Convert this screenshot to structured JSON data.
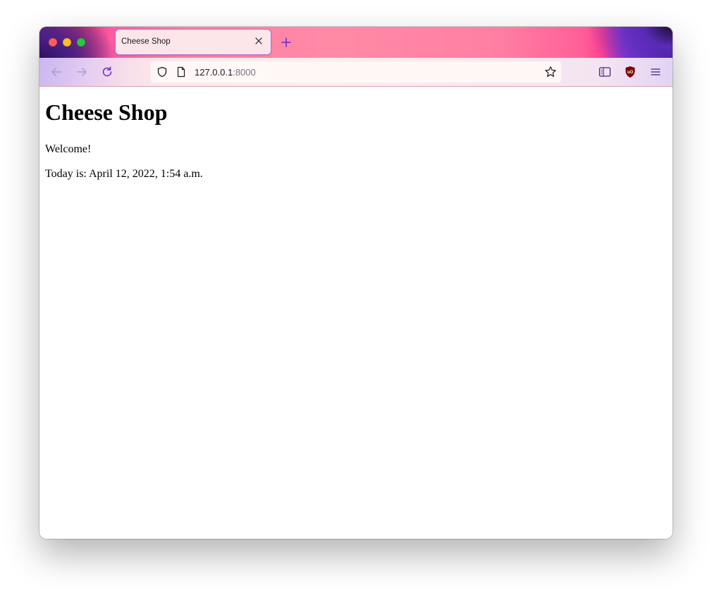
{
  "browser": {
    "tab": {
      "title": "Cheese Shop"
    },
    "url": {
      "host": "127.0.0.1",
      "port": ":8000"
    },
    "icons": {
      "close": "close-icon",
      "new_tab": "plus-icon",
      "back": "back-arrow-icon",
      "forward": "forward-arrow-icon",
      "reload": "reload-icon",
      "shield": "shield-icon",
      "page": "page-icon",
      "bookmark": "star-icon",
      "sidebar": "sidebar-icon",
      "ublock": "ublock-origin-icon",
      "menu": "hamburger-menu-icon"
    },
    "colors": {
      "traffic_red": "#ff5f57",
      "traffic_yellow": "#febc2e",
      "traffic_green": "#28c840",
      "accent_purple": "#8e3fd6",
      "ublock_red": "#800000"
    }
  },
  "page": {
    "heading": "Cheese Shop",
    "welcome": "Welcome!",
    "today": "Today is: April 12, 2022, 1:54 a.m."
  }
}
